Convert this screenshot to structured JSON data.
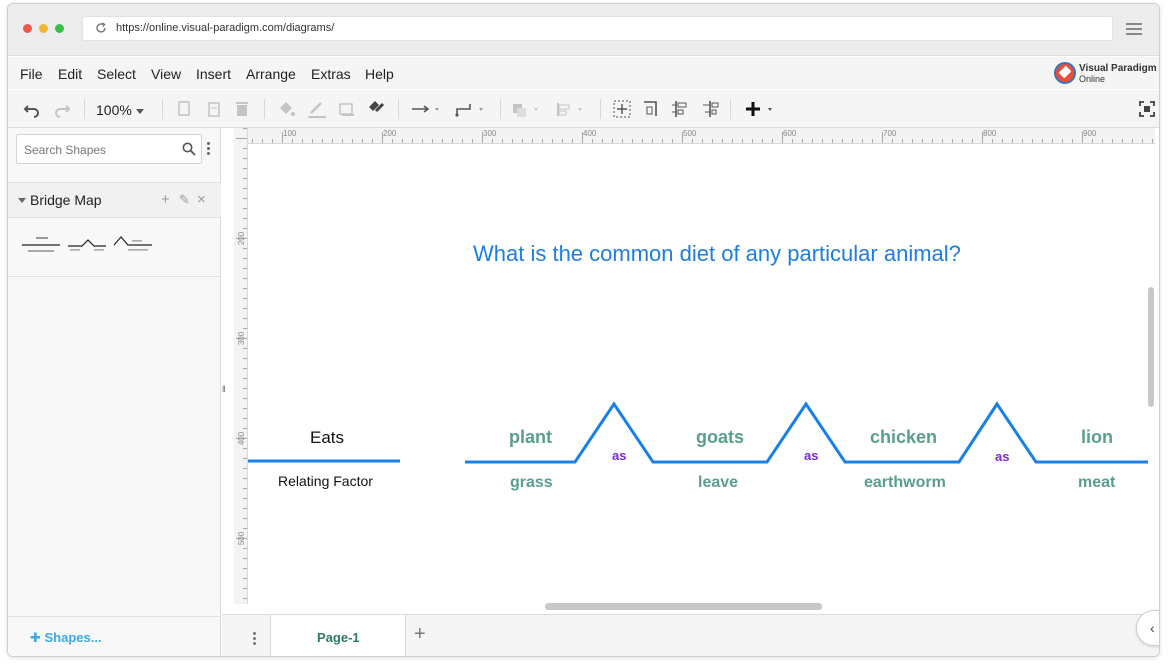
{
  "browser": {
    "url": "https://online.visual-paradigm.com/diagrams/"
  },
  "menubar": {
    "items": [
      "File",
      "Edit",
      "Select",
      "View",
      "Insert",
      "Arrange",
      "Extras",
      "Help"
    ],
    "logo_line1": "Visual Paradigm",
    "logo_line2": "Online"
  },
  "toolbar": {
    "zoom": "100%"
  },
  "sidebar": {
    "search_placeholder": "Search Shapes",
    "section_title": "Bridge Map",
    "shapes_link": "Shapes..."
  },
  "rulers": {
    "top": [
      "100",
      "200",
      "300",
      "400",
      "500",
      "600",
      "700",
      "800",
      "900"
    ],
    "left": [
      "200",
      "300",
      "400",
      "500"
    ]
  },
  "diagram": {
    "question": "What is the common diet of any particular animal?",
    "relating_word": "Eats",
    "relating_caption": "Relating Factor",
    "as_word": "as",
    "pairs": [
      {
        "top": "plant",
        "bottom": "grass"
      },
      {
        "top": "goats",
        "bottom": "leave"
      },
      {
        "top": "chicken",
        "bottom": "earthworm"
      },
      {
        "top": "lion",
        "bottom": "meat"
      }
    ],
    "colors": {
      "question": "#1e7ee0",
      "lines": "#1a7fe6",
      "labels": "#5a9e8d",
      "as": "#7a2bd6"
    }
  },
  "pages": {
    "active": "Page-1"
  }
}
